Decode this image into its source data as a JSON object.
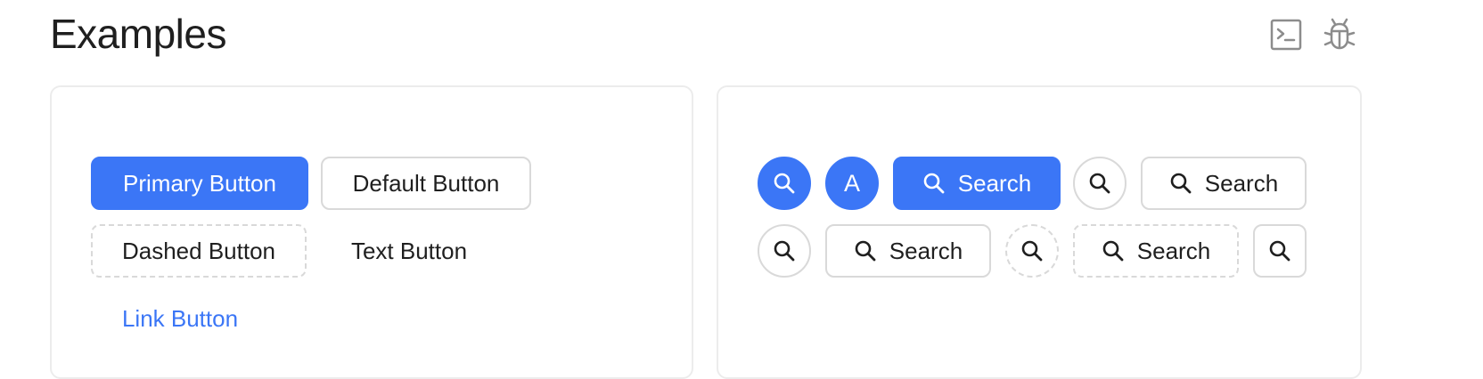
{
  "page": {
    "title": "Examples"
  },
  "toolbar": {
    "terminal_icon": "terminal-icon",
    "bug_icon": "bug-icon"
  },
  "left_card": {
    "primary_label": "Primary Button",
    "default_label": "Default Button",
    "dashed_label": "Dashed Button",
    "text_label": "Text Button",
    "link_label": "Link Button"
  },
  "right_card": {
    "avatar_letter": "A",
    "search_label": "Search",
    "icon": "search-icon"
  },
  "colors": {
    "primary": "#3b76f6",
    "border": "#d9d9d9",
    "text": "#1f1f1f",
    "icon_gray": "#8c8c8c"
  }
}
